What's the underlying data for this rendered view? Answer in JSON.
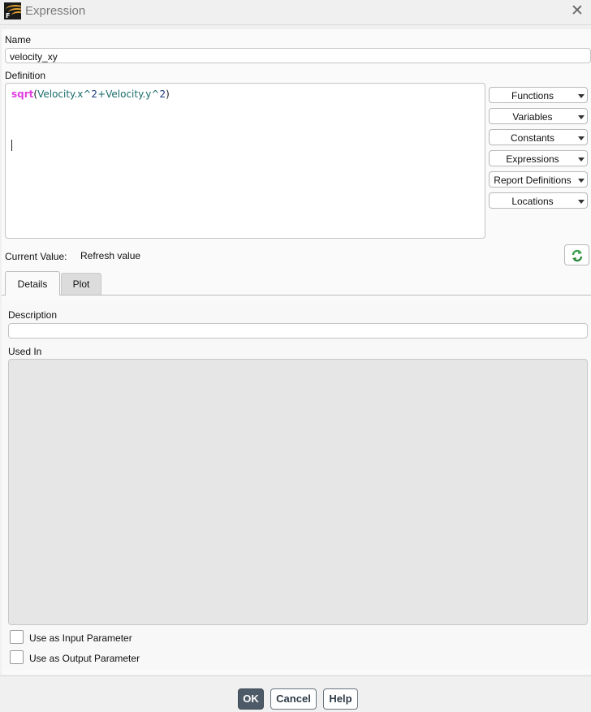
{
  "window": {
    "title": "Expression",
    "icon": "fluent-app-icon",
    "icon_letter": "F"
  },
  "name": {
    "label": "Name",
    "value": "velocity_xy"
  },
  "definition": {
    "label": "Definition",
    "tokens": [
      {
        "text": "sqrt",
        "kind": "fn"
      },
      {
        "text": "(",
        "kind": "par"
      },
      {
        "text": "Velocity.x",
        "kind": "var"
      },
      {
        "text": "^",
        "kind": "op"
      },
      {
        "text": "2",
        "kind": "num"
      },
      {
        "text": "+",
        "kind": "op"
      },
      {
        "text": "Velocity.y",
        "kind": "var"
      },
      {
        "text": "^",
        "kind": "op"
      },
      {
        "text": "2",
        "kind": "num"
      },
      {
        "text": ")",
        "kind": "par"
      }
    ]
  },
  "side_buttons": [
    "Functions",
    "Variables",
    "Constants",
    "Expressions",
    "Report Definitions",
    "Locations"
  ],
  "current_value": {
    "label": "Current Value:",
    "value": "Refresh value",
    "refresh_icon": "refresh-icon"
  },
  "tabs": [
    {
      "label": "Details",
      "active": true
    },
    {
      "label": "Plot",
      "active": false
    }
  ],
  "details": {
    "description_label": "Description",
    "description_value": "",
    "used_in_label": "Used In"
  },
  "checkboxes": [
    {
      "label": "Use as Input Parameter",
      "checked": false
    },
    {
      "label": "Use as Output Parameter",
      "checked": false
    }
  ],
  "footer": {
    "ok": "OK",
    "cancel": "Cancel",
    "help": "Help"
  },
  "colors": {
    "ok_button": "#4d5b68",
    "function_token": "#e040e0",
    "variable_token": "#1a6b6b"
  }
}
